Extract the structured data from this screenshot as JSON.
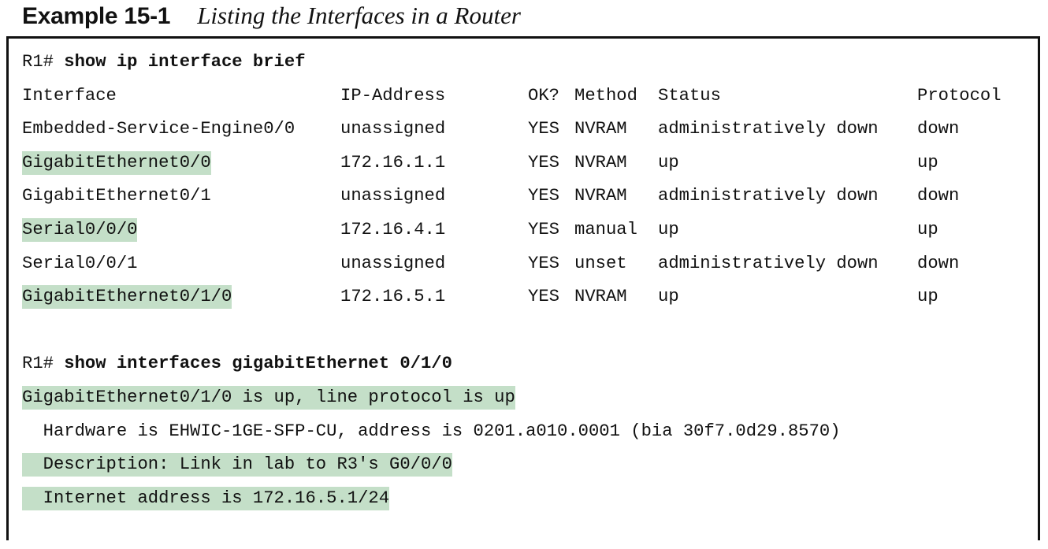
{
  "caption": {
    "label": "Example 15-1",
    "title": "Listing the Interfaces in a Router"
  },
  "cmd1": {
    "prompt": "R1# ",
    "command": "show ip interface brief"
  },
  "table": {
    "headers": [
      "Interface",
      "IP-Address",
      "OK?",
      "Method",
      "Status",
      "Protocol"
    ],
    "rows": [
      {
        "interface": "Embedded-Service-Engine0/0",
        "ip": "unassigned",
        "ok": "YES",
        "method": "NVRAM",
        "status": "administratively down",
        "protocol": "down",
        "highlight": false
      },
      {
        "interface": "GigabitEthernet0/0",
        "ip": "172.16.1.1",
        "ok": "YES",
        "method": "NVRAM",
        "status": "up",
        "protocol": "up",
        "highlight": true
      },
      {
        "interface": "GigabitEthernet0/1",
        "ip": "unassigned",
        "ok": "YES",
        "method": "NVRAM",
        "status": "administratively down",
        "protocol": "down",
        "highlight": false
      },
      {
        "interface": "Serial0/0/0",
        "ip": "172.16.4.1",
        "ok": "YES",
        "method": "manual",
        "status": "up",
        "protocol": "up",
        "highlight": true
      },
      {
        "interface": "Serial0/0/1",
        "ip": "unassigned",
        "ok": "YES",
        "method": "unset",
        "status": "administratively down",
        "protocol": "down",
        "highlight": false
      },
      {
        "interface": "GigabitEthernet0/1/0",
        "ip": "172.16.5.1",
        "ok": "YES",
        "method": "NVRAM",
        "status": "up",
        "protocol": "up",
        "highlight": true
      }
    ]
  },
  "cmd2": {
    "prompt": "R1# ",
    "command": "show interfaces gigabitEthernet 0/1/0"
  },
  "details": {
    "status_line": "GigabitEthernet0/1/0 is up, line protocol is up",
    "hardware_line": "  Hardware is EHWIC-1GE-SFP-CU, address is 0201.a010.0001 (bia 30f7.0d29.8570)",
    "description_line": "  Description: Link in lab to R3's G0/0/0",
    "address_line": "  Internet address is 172.16.5.1/24"
  },
  "colors": {
    "highlight": "#c4dfc8",
    "border": "#111111"
  }
}
